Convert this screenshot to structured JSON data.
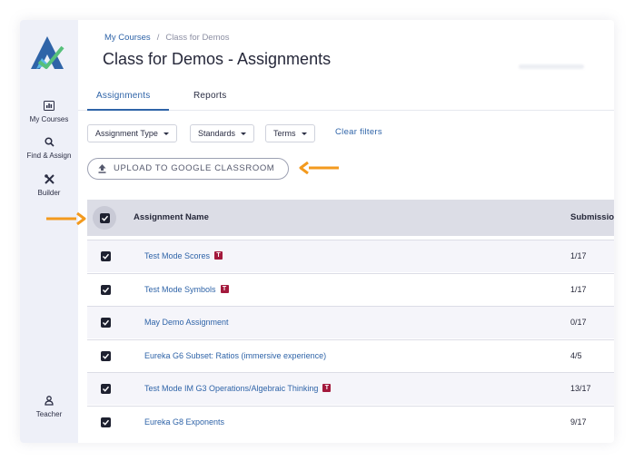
{
  "sidebar": {
    "logo_icon": "app-logo",
    "items": [
      {
        "label": "My Courses",
        "icon": "courses-icon"
      },
      {
        "label": "Find & Assign",
        "icon": "search-icon"
      },
      {
        "label": "Builder",
        "icon": "tools-icon"
      }
    ],
    "user": {
      "label": "Teacher",
      "icon": "user-icon"
    }
  },
  "breadcrumb": {
    "root": "My Courses",
    "separator": "/",
    "current": "Class for Demos"
  },
  "page_title": "Class for Demos - Assignments",
  "tabs": [
    {
      "label": "Assignments",
      "active": true
    },
    {
      "label": "Reports",
      "active": false
    }
  ],
  "filters": {
    "assignment_type": "Assignment Type",
    "standards": "Standards",
    "terms": "Terms",
    "clear": "Clear filters"
  },
  "upload_button": "UPLOAD TO GOOGLE CLASSROOM",
  "table": {
    "headers": {
      "name": "Assignment Name",
      "submissions": "Submissions"
    },
    "rows": [
      {
        "name": "Test Mode Scores",
        "badge": "T",
        "submissions": "1/17",
        "checked": true
      },
      {
        "name": "Test Mode Symbols",
        "badge": "T",
        "submissions": "1/17",
        "checked": true
      },
      {
        "name": "May Demo Assignment",
        "badge": "",
        "submissions": "0/17",
        "checked": true
      },
      {
        "name": "Eureka G6 Subset: Ratios (immersive experience)",
        "badge": "",
        "submissions": "4/5",
        "checked": true
      },
      {
        "name": "Test Mode IM G3 Operations/Algebraic Thinking",
        "badge": "T",
        "submissions": "13/17",
        "checked": true
      },
      {
        "name": "Eureka G8 Exponents",
        "badge": "",
        "submissions": "9/17",
        "checked": true
      }
    ]
  },
  "colors": {
    "accent": "#2f64a8",
    "badge": "#a3193c",
    "arrow": "#f39a1e",
    "sidebar": "#eef0f8"
  }
}
